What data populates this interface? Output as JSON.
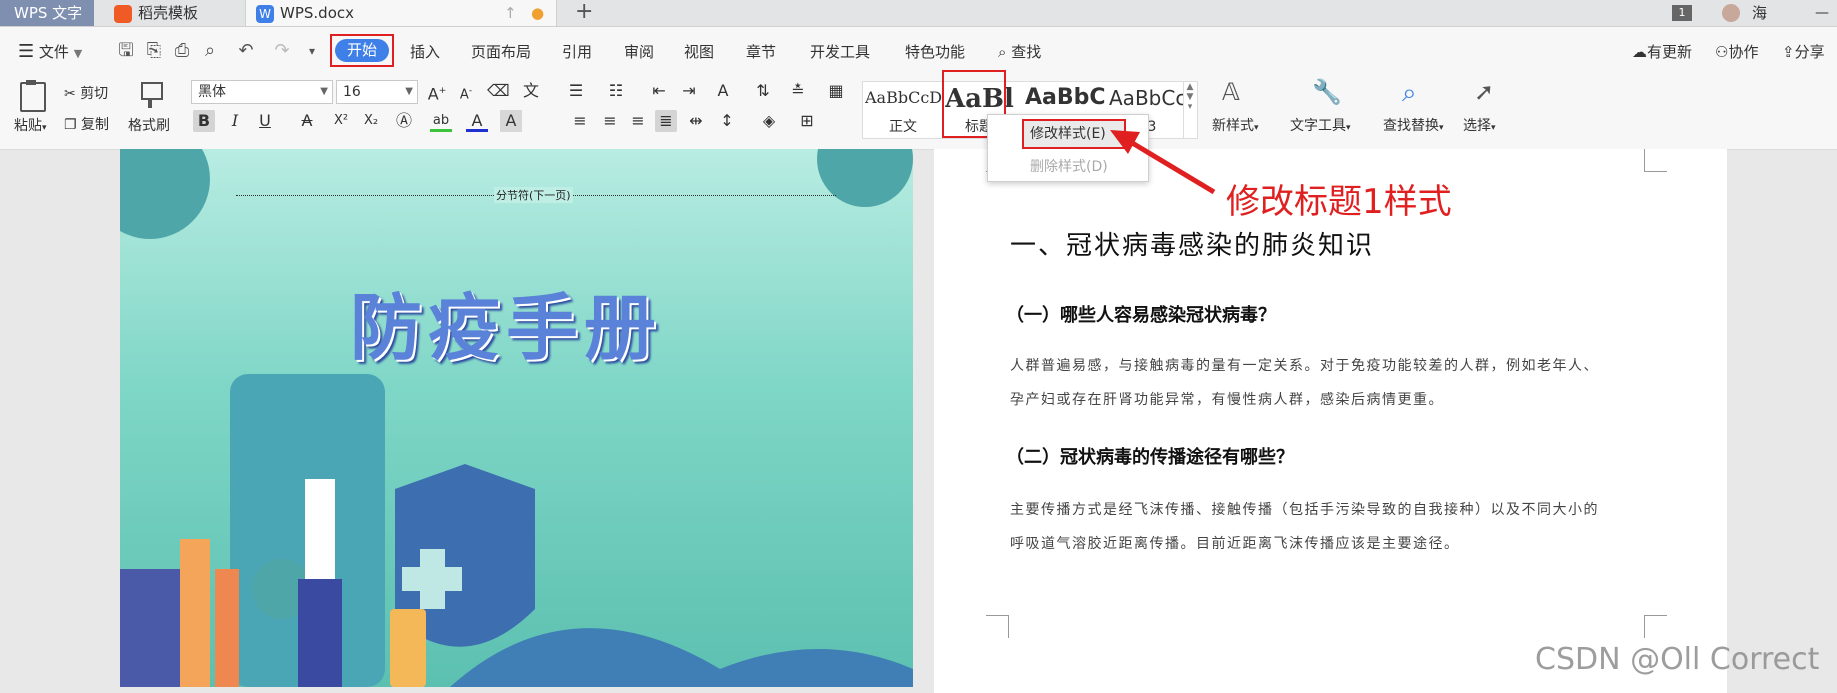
{
  "tabs": {
    "app": "WPS 文字",
    "template_tab": "稻壳模板",
    "doc_tab": "WPS.docx",
    "new_tab": "+",
    "window_count": "1",
    "user_name": "海",
    "minimize": "—"
  },
  "menubar": {
    "file": "文件",
    "items": [
      "开始",
      "插入",
      "页面布局",
      "引用",
      "审阅",
      "视图",
      "章节",
      "开发工具",
      "特色功能"
    ],
    "search": "查找",
    "right": [
      "有更新",
      "协作",
      "分享"
    ]
  },
  "ribbon": {
    "paste": "粘贴",
    "cut": "剪切",
    "copy": "复制",
    "format_painter": "格式刷",
    "font_name": "黑体",
    "font_size": "16",
    "styles": [
      {
        "sample": "AaBbCcDd",
        "label": "正文"
      },
      {
        "sample": "AaBl",
        "label": "标题"
      },
      {
        "sample": "AaBbC",
        "label": ""
      },
      {
        "sample": "AaBbCc",
        "label": "题 3"
      }
    ],
    "new_style": "新样式",
    "text_tools": "文字工具",
    "find_replace": "查找替换",
    "select": "选择"
  },
  "style_menu": {
    "modify": "修改样式(E)",
    "delete": "删除样式(D)"
  },
  "annotation": {
    "text": "修改标题1样式",
    "color": "#e02020"
  },
  "cover": {
    "section_break": "分节符(下一页)",
    "title": "防疫手册"
  },
  "document": {
    "heading1": "一、冠状病毒感染的肺炎知识",
    "sub1": "（一）哪些人容易感染冠状病毒？",
    "para1_line1": "人群普遍易感，与接触病毒的量有一定关系。对于免疫功能较差的人群，例如老年人、",
    "para1_line2": "孕产妇或存在肝肾功能异常，有慢性病人群，感染后病情更重。",
    "sub2": "（二）冠状病毒的传播途径有哪些？",
    "para2_line1": "主要传播方式是经飞沫传播、接触传播（包括手污染导致的自我接种）以及不同大小的",
    "para2_line2": "呼吸道气溶胶近距离传播。目前近距离飞沫传播应该是主要途径。"
  },
  "watermark": "CSDN @Oll Correct",
  "colors": {
    "accent": "#3f7fe8",
    "highlight_border": "#e02020"
  }
}
